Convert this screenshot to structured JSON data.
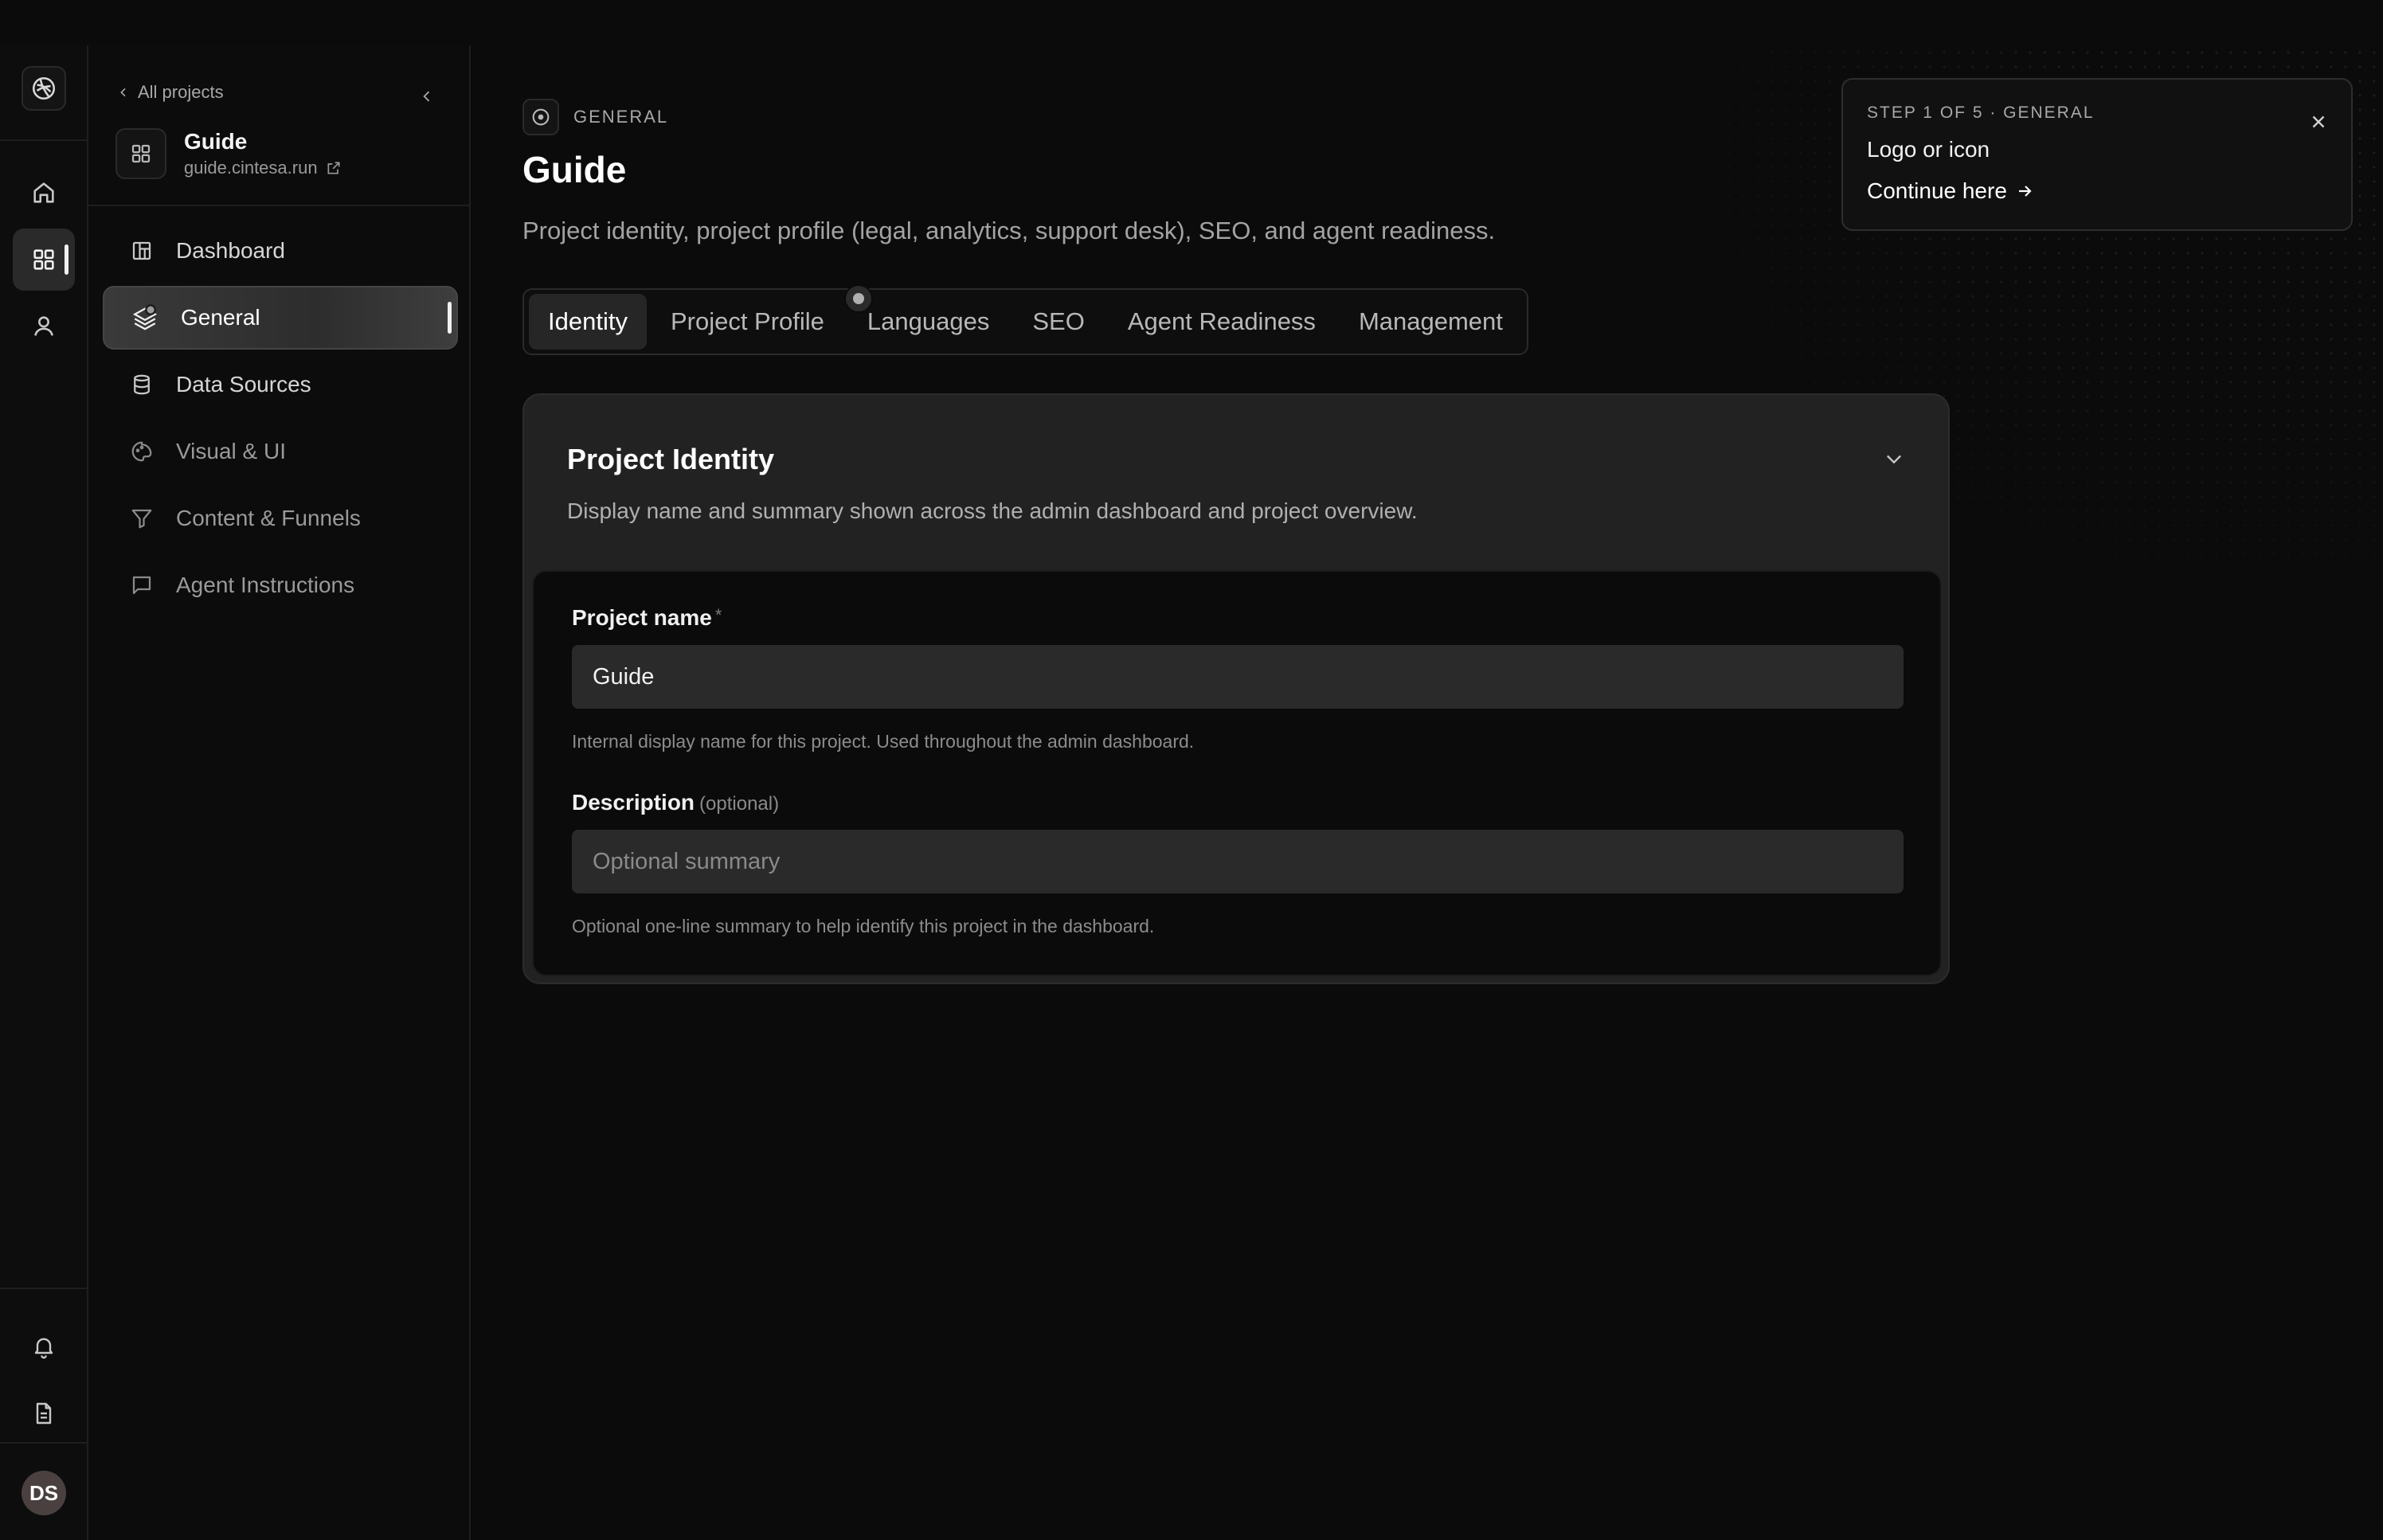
{
  "sidebar": {
    "back_label": "All projects",
    "project_name": "Guide",
    "project_url": "guide.cintesa.run",
    "items": [
      {
        "label": "Dashboard",
        "icon": "dashboard-icon"
      },
      {
        "label": "General",
        "icon": "layers-icon",
        "active": true
      },
      {
        "label": "Data Sources",
        "icon": "database-icon"
      },
      {
        "label": "Visual & UI",
        "icon": "palette-icon"
      },
      {
        "label": "Content & Funnels",
        "icon": "funnel-icon"
      },
      {
        "label": "Agent Instructions",
        "icon": "message-icon"
      }
    ]
  },
  "rail": {
    "avatar_initials": "DS"
  },
  "header": {
    "section_label": "GENERAL",
    "title": "Guide",
    "subtitle": "Project identity, project profile (legal, analytics, support desk), SEO, and agent readiness."
  },
  "tabs": [
    {
      "label": "Identity",
      "active": true
    },
    {
      "label": "Project Profile"
    },
    {
      "label": "Languages"
    },
    {
      "label": "SEO"
    },
    {
      "label": "Agent Readiness"
    },
    {
      "label": "Management"
    }
  ],
  "card": {
    "title": "Project Identity",
    "description": "Display name and summary shown across the admin dashboard and project overview.",
    "name_label": "Project name",
    "name_required": "*",
    "name_value": "Guide",
    "name_help": "Internal display name for this project. Used throughout the admin dashboard.",
    "desc_label": "Description",
    "desc_optional": "(optional)",
    "desc_placeholder": "Optional summary",
    "desc_help": "Optional one-line summary to help identify this project in the dashboard."
  },
  "tour": {
    "step": "STEP 1 OF 5 · GENERAL",
    "text": "Logo or icon",
    "link": "Continue here"
  },
  "colors": {
    "background": "#0b0b0b",
    "card": "#222222",
    "input": "#2a2a2a",
    "accent": "#ffffff"
  }
}
